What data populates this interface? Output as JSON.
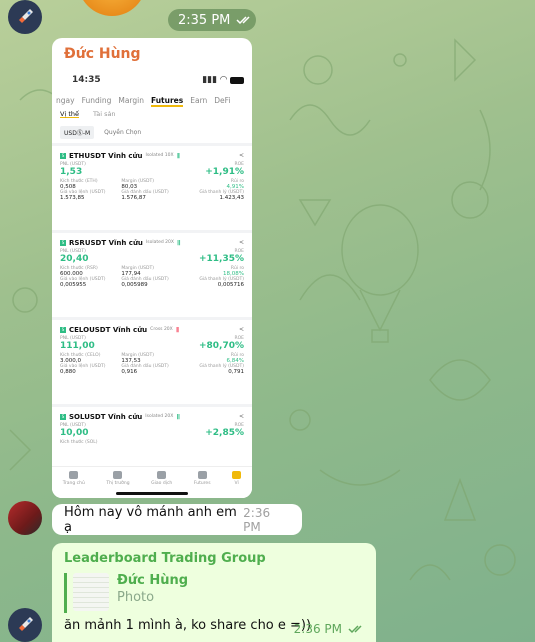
{
  "chat": {
    "top_time": "2:35 PM",
    "photo_sender": "Đức Hùng",
    "message1_text": "Hôm nay vô mánh anh em ạ",
    "message1_time": "2:36 PM",
    "reply_group": "Leaderboard Trading Group",
    "reply_quote_name": "Đức Hùng",
    "reply_quote_type": "Photo",
    "reply_text": "ăn mảnh 1 mình à, ko share cho e =))",
    "reply_time": "2:36 PM"
  },
  "screenshot": {
    "status_time": "14:35",
    "tabs": [
      "ngay",
      "Funding",
      "Margin",
      "Futures",
      "Earn",
      "DeFi"
    ],
    "active_tab": "Futures",
    "subtabs": [
      "Vị thế",
      "Tài sản"
    ],
    "filter_selected": "USDⓈ-M",
    "filter_other": "Quyền Chọn",
    "positions": [
      {
        "symbol": "ETHUSDT Vĩnh cửu",
        "tag": "Isolated 10X",
        "bars": "||||",
        "pnl_label": "PNL (USDT)",
        "pnl": "1,53",
        "roe_label": "ROE",
        "roe": "+1,91%",
        "size_label": "Kích thước (ETH)",
        "size": "0,508",
        "margin_label": "Margin (USDT)",
        "margin": "80,03",
        "risk_label": "Rủi ro",
        "risk": "4,91%",
        "entry_label": "Giá vào lệnh (USDT)",
        "entry": "1.573,85",
        "mark_label": "Giá đánh dấu (USDT)",
        "mark": "1.576,87",
        "liq_label": "Giá thanh lý (USDT)",
        "liq": "1.423,43"
      },
      {
        "symbol": "RSRUSDT Vĩnh cửu",
        "tag": "Isolated 20X",
        "bars": "||||",
        "pnl_label": "PNL (USDT)",
        "pnl": "20,40",
        "roe_label": "ROE",
        "roe": "+11,35%",
        "size_label": "Kích thước (RSR)",
        "size": "600.000",
        "margin_label": "Margin (USDT)",
        "margin": "177,94",
        "risk_label": "Rủi ro",
        "risk": "18,08%",
        "entry_label": "Giá vào lệnh (USDT)",
        "entry": "0,005955",
        "mark_label": "Giá đánh dấu (USDT)",
        "mark": "0,005989",
        "liq_label": "Giá thanh lý (USDT)",
        "liq": "0,005716"
      },
      {
        "symbol": "CELOUSDT Vĩnh cửu",
        "tag": "Cross 20X",
        "bars": "||||",
        "pnl_label": "PNL (USDT)",
        "pnl": "111,00",
        "roe_label": "ROE",
        "roe": "+80,70%",
        "size_label": "Kích thước (CELO)",
        "size": "3.000,0",
        "margin_label": "Margin (USDT)",
        "margin": "137,53",
        "risk_label": "Rủi ro",
        "risk": "6,84%",
        "entry_label": "Giá vào lệnh (USDT)",
        "entry": "0,880",
        "mark_label": "Giá đánh dấu (USDT)",
        "mark": "0,916",
        "liq_label": "Giá thanh lý (USDT)",
        "liq": "0,791"
      },
      {
        "symbol": "SOLUSDT Vĩnh cửu",
        "tag": "Isolated 20X",
        "bars": "||||",
        "pnl_label": "PNL (USDT)",
        "pnl": "10,00",
        "roe_label": "ROE",
        "roe": "+2,85%",
        "size_label": "Kích thước (SOL)",
        "size": "",
        "margin_label": "",
        "margin": "",
        "risk_label": "",
        "risk": "",
        "entry_label": "",
        "entry": "",
        "mark_label": "",
        "mark": "",
        "liq_label": "",
        "liq": ""
      }
    ],
    "bottom_nav": [
      "Trang chủ",
      "Thị trường",
      "Giao dịch",
      "Futures",
      "Ví"
    ]
  },
  "colors": {
    "sender_orange": "#e0703a",
    "group_green": "#4fae4e",
    "profit_green": "#2ebd85",
    "accent_yellow": "#f0b90b"
  }
}
